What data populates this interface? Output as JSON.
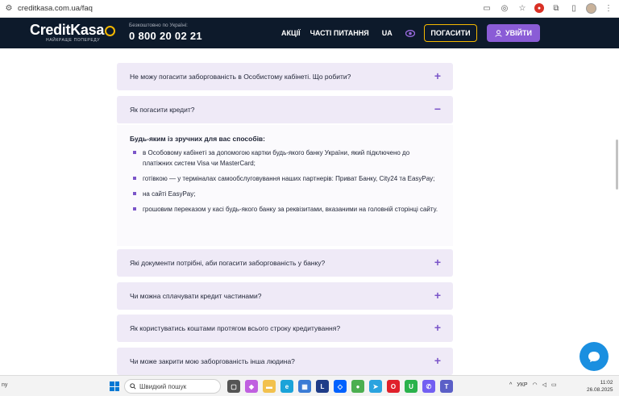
{
  "browser": {
    "url": "creditkasa.com.ua/faq"
  },
  "header": {
    "logo": {
      "part1": "Credit",
      "part2": "Kasa",
      "tagline": "НАЙКРАЩЕ ПОПЕРЕДУ"
    },
    "phone_caption": "Безкоштовно по Україні:",
    "phone": "0 800 20 02 21",
    "nav": [
      "АКЦІЇ",
      "ЧАСТІ ПИТАННЯ"
    ],
    "lang": "UA",
    "pay_label": "ПОГАСИТИ",
    "login_label": "УВІЙТИ",
    "accent_color": "#8a5cd6",
    "yellow_color": "#f5b800"
  },
  "faq": {
    "items": [
      {
        "question": "Не можу погасити заборгованість в Особистому кабінеті. Що робити?",
        "toggle": "+"
      },
      {
        "question": "Як погасити кредит?",
        "toggle": "−"
      },
      {
        "question": "Які документи потрібні, аби погасити заборгованість у банку?",
        "toggle": "+"
      },
      {
        "question": "Чи можна сплачувати кредит частинами?",
        "toggle": "+"
      },
      {
        "question": "Як користуватись коштами протягом всього строку кредитування?",
        "toggle": "+"
      },
      {
        "question": "Чи може закрити мою заборгованість інша людина?",
        "toggle": "+"
      }
    ],
    "answer": {
      "intro": "Будь-яким із зручних для вас способів:",
      "points": [
        "в Особовому кабінеті за допомогою картки будь-якого банку України, який підключено до платіжних систем Visa чи MasterCard;",
        "готівкою — у терміналах самообслуговування наших партнерів: Приват Банку, City24 та EasyPay;",
        "на сайті EasyPay;",
        "грошовим переказом у касі будь-якого банку за реквізитами, вказаними на головній сторінці сайту."
      ]
    }
  },
  "taskbar": {
    "left_text": "ny",
    "search_placeholder": "Швидкий пошук",
    "lang": "УКР",
    "time": "11:02",
    "date": "26.08.2025"
  }
}
